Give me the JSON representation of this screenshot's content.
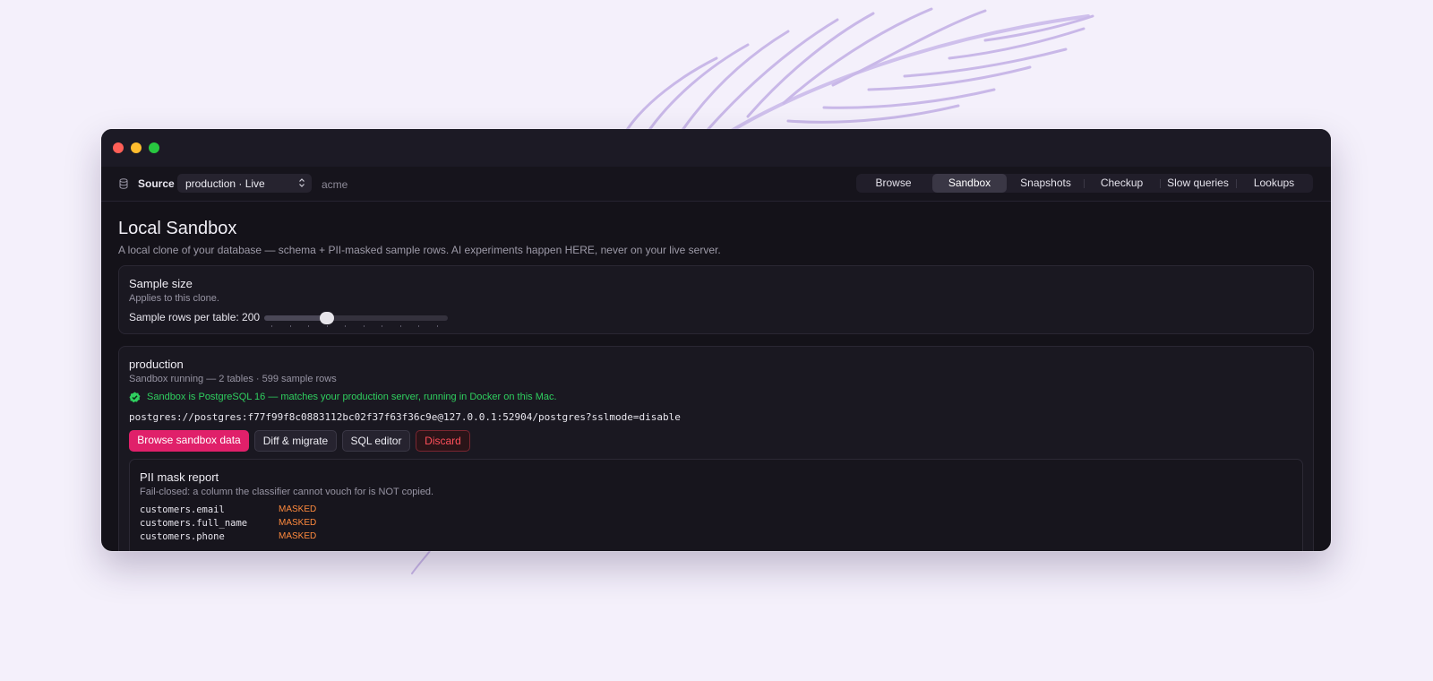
{
  "toolbar": {
    "source_label": "Source",
    "source_value": "production · Live",
    "workspace": "acme",
    "tabs": [
      {
        "label": "Browse"
      },
      {
        "label": "Sandbox"
      },
      {
        "label": "Snapshots"
      },
      {
        "label": "Checkup"
      },
      {
        "label": "Slow queries"
      },
      {
        "label": "Lookups"
      }
    ],
    "active_tab": "Sandbox"
  },
  "page": {
    "title": "Local Sandbox",
    "subtitle": "A local clone of your database — schema + PII-masked sample rows. AI experiments happen HERE, never on your live server."
  },
  "sample_size": {
    "title": "Sample size",
    "subtitle": "Applies to this clone.",
    "slider_label": "Sample rows per table: 200",
    "slider_fraction": 0.34
  },
  "sandbox": {
    "name": "production",
    "summary": "Sandbox running — 2 tables · 599 sample rows",
    "status": "Sandbox is PostgreSQL 16 — matches your production server, running in Docker on this Mac.",
    "connection": "postgres://postgres:f77f99f8c0883112bc02f37f63f36c9e@127.0.0.1:52904/postgres?sslmode=disable",
    "buttons": {
      "browse": "Browse sandbox data",
      "diff": "Diff & migrate",
      "sql": "SQL editor",
      "discard": "Discard"
    }
  },
  "pii_report": {
    "title": "PII mask report",
    "subtitle": "Fail-closed: a column the classifier cannot vouch for is NOT copied.",
    "rows": [
      {
        "column": "customers.email",
        "status": "MASKED"
      },
      {
        "column": "customers.full_name",
        "status": "MASKED"
      },
      {
        "column": "customers.phone",
        "status": "MASKED"
      }
    ]
  },
  "colors": {
    "accent": "#e0206a",
    "success": "#2fcf5f",
    "danger": "#ff4f5a",
    "masked": "#ff8a3d"
  }
}
